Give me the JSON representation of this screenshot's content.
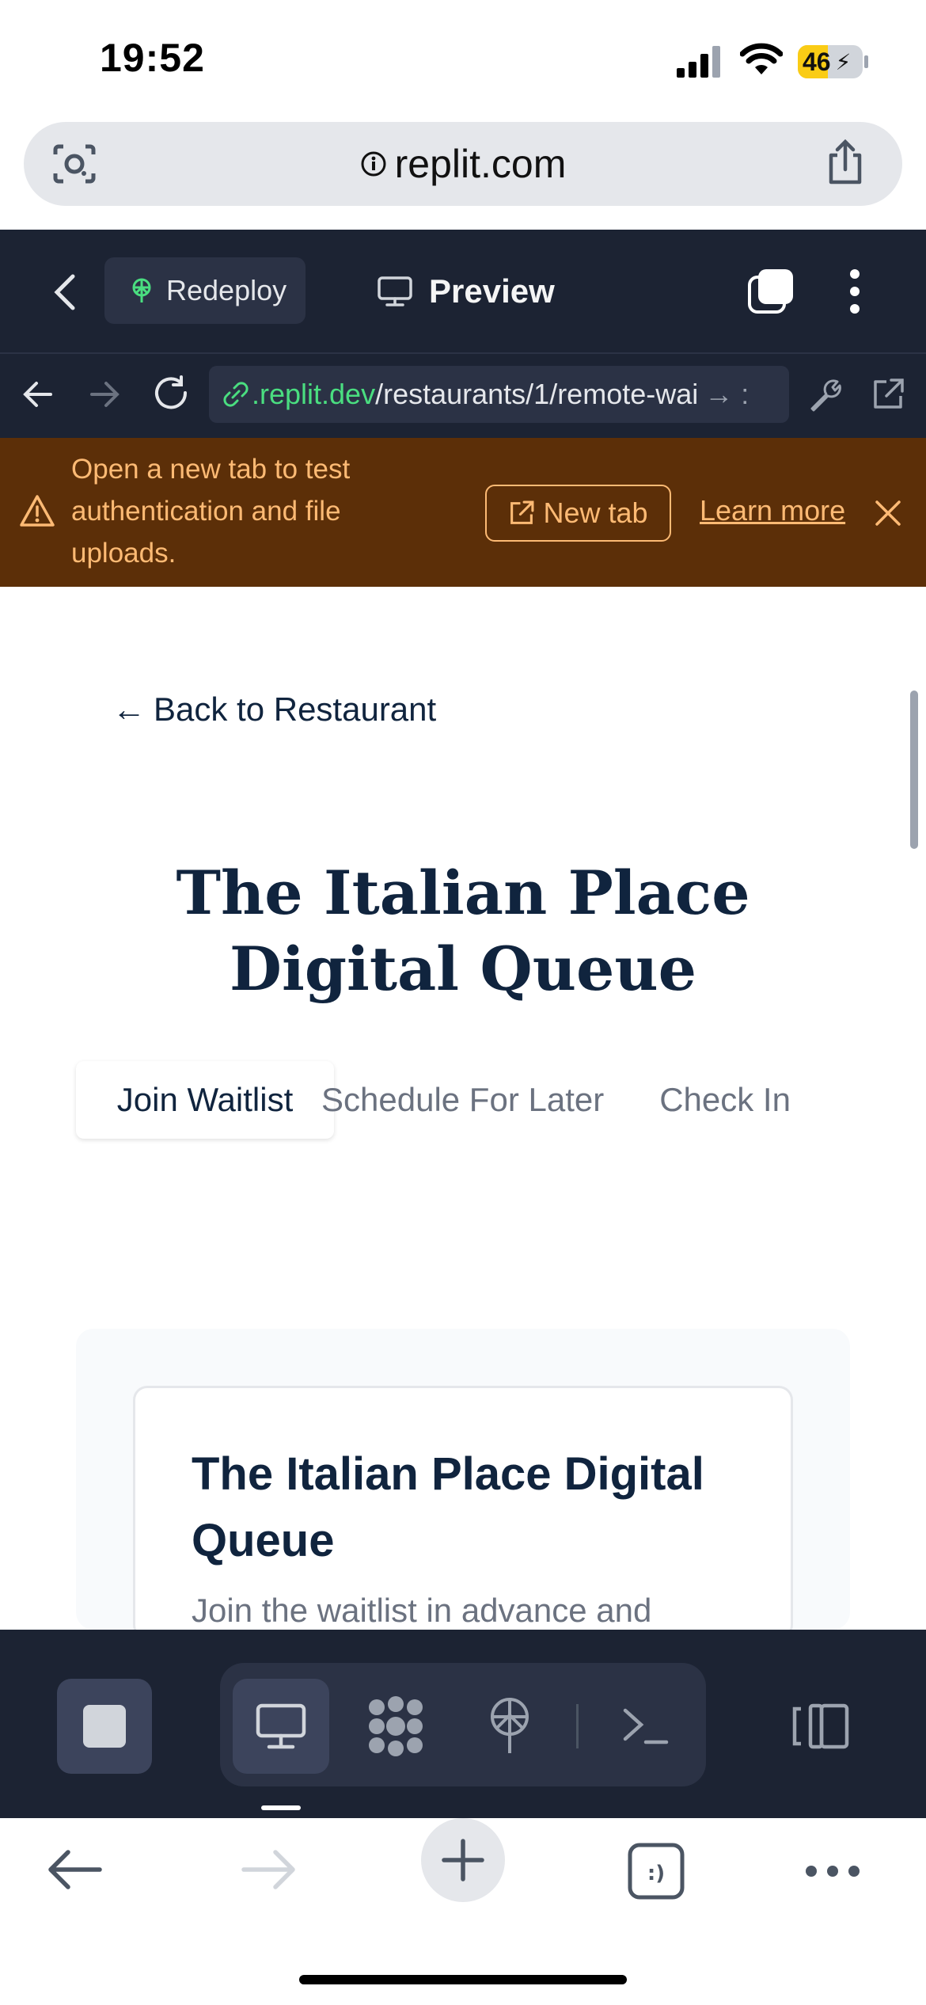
{
  "status_bar": {
    "time": "19:52",
    "battery": "46",
    "battery_level": 0.46
  },
  "safari": {
    "url": "replit.com"
  },
  "replit_header": {
    "redeploy_label": "Redeploy",
    "preview_label": "Preview"
  },
  "preview_nav": {
    "url_host": ".replit.dev",
    "url_path": "/restaurants/1/remote-wai",
    "url_tail": "→ :"
  },
  "banner": {
    "message": "Open a new tab to test authentication and file uploads.",
    "new_tab_label": "New tab",
    "learn_more_label": "Learn more"
  },
  "page": {
    "back_link": "Back to Restaurant",
    "title": "The Italian Place Digital Queue",
    "tabs": [
      {
        "label": "Join Waitlist",
        "active": true
      },
      {
        "label": "Schedule For Later",
        "active": false
      },
      {
        "label": "Check In",
        "active": false
      }
    ],
    "card": {
      "title": "The Italian Place Digital Queue",
      "subtitle": "Join the waitlist in advance and"
    }
  },
  "colors": {
    "replit_dark": "#1c2333",
    "banner_bg": "#5c2f08",
    "banner_text": "#fdba74",
    "heading": "#10243e",
    "link_green": "#4ade80"
  }
}
